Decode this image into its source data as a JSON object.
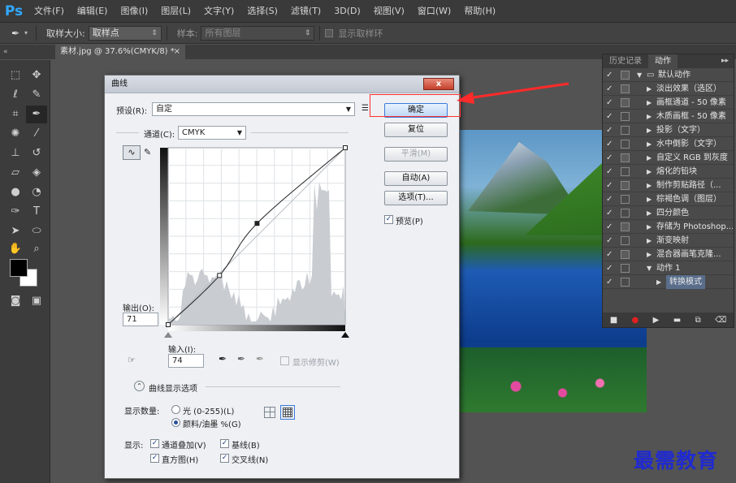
{
  "app": {
    "logo": "Ps"
  },
  "menubar": {
    "items": [
      "文件(F)",
      "编辑(E)",
      "图像(I)",
      "图层(L)",
      "文字(Y)",
      "选择(S)",
      "滤镜(T)",
      "3D(D)",
      "视图(V)",
      "窗口(W)",
      "帮助(H)"
    ]
  },
  "options": {
    "sample_size_label": "取样大小:",
    "sample_size_value": "取样点",
    "sample_label": "样本:",
    "sample_value": "所有图层",
    "show_ring_label": "显示取样环"
  },
  "document": {
    "tab_title": "素材.jpg @ 37.6%(CMYK/8) *",
    "close_glyph": "×"
  },
  "colors": {
    "accent": "#31a8ff",
    "highlight": "#ff3030",
    "watermark": "#1f2ad0",
    "foreground": "#000000",
    "background": "#ffffff"
  },
  "actions_panel": {
    "tabs": [
      "历史记录",
      "动作"
    ],
    "active_tab": 1,
    "menu_glyph": "▸▸",
    "rows": [
      {
        "name": "默认动作",
        "level": 0,
        "folder": true,
        "expanded": true,
        "dialog": true
      },
      {
        "name": "淡出效果（选区）",
        "level": 1,
        "dialog": true
      },
      {
        "name": "画框通道 - 50 像素",
        "level": 1,
        "dialog": true
      },
      {
        "name": "木质画框 - 50 像素",
        "level": 1,
        "dialog": false
      },
      {
        "name": "投影（文字）",
        "level": 1,
        "dialog": false
      },
      {
        "name": "水中倒影（文字）",
        "level": 1,
        "dialog": false
      },
      {
        "name": "自定义 RGB 到灰度",
        "level": 1,
        "dialog": true
      },
      {
        "name": "熔化的铅块",
        "level": 1,
        "dialog": false
      },
      {
        "name": "制作剪贴路径（...",
        "level": 1,
        "dialog": true
      },
      {
        "name": "棕褐色调（图层）",
        "level": 1,
        "dialog": false
      },
      {
        "name": "四分颜色",
        "level": 1,
        "dialog": false
      },
      {
        "name": "存储为 Photoshop...",
        "level": 1,
        "dialog": true
      },
      {
        "name": "渐变映射",
        "level": 1,
        "dialog": false
      },
      {
        "name": "混合器画笔克隆...",
        "level": 1,
        "dialog": true
      },
      {
        "name": "动作 1",
        "level": 1,
        "expanded": true,
        "dialog": false
      },
      {
        "name": "转换模式",
        "level": 2,
        "dialog": false,
        "selected": true
      }
    ],
    "bottom_icons": [
      "stop-icon",
      "record-icon",
      "play-icon",
      "folder-icon",
      "new-icon",
      "delete-icon"
    ]
  },
  "curves": {
    "title": "曲线",
    "close_glyph": "x",
    "preset_label": "预设(R):",
    "preset_value": "自定",
    "channel_label": "通道(C):",
    "channel_value": "CMYK",
    "output_label": "输出(O):",
    "output_value": "71",
    "input_label": "输入(I):",
    "input_value": "74",
    "show_clipping_label": "显示修剪(W)",
    "display_options_label": "曲线显示选项",
    "display_amount_label": "显示数量:",
    "light_label": "光 (0-255)(L)",
    "pigment_label": "颜料/油墨 %(G)",
    "show_label": "显示:",
    "channel_overlay_label": "通道叠加(V)",
    "baseline_label": "基线(B)",
    "histogram_label": "直方图(H)",
    "intersection_label": "交叉线(N)",
    "buttons": {
      "ok": "确定",
      "reset": "复位",
      "smooth": "平滑(M)",
      "auto": "自动(A)",
      "options": "选项(T)...",
      "preview": "预览(P)"
    },
    "curve_points": [
      [
        0,
        0
      ],
      [
        74,
        71
      ],
      [
        128,
        146
      ],
      [
        255,
        255
      ]
    ]
  },
  "watermark": {
    "text": "最需教育"
  }
}
